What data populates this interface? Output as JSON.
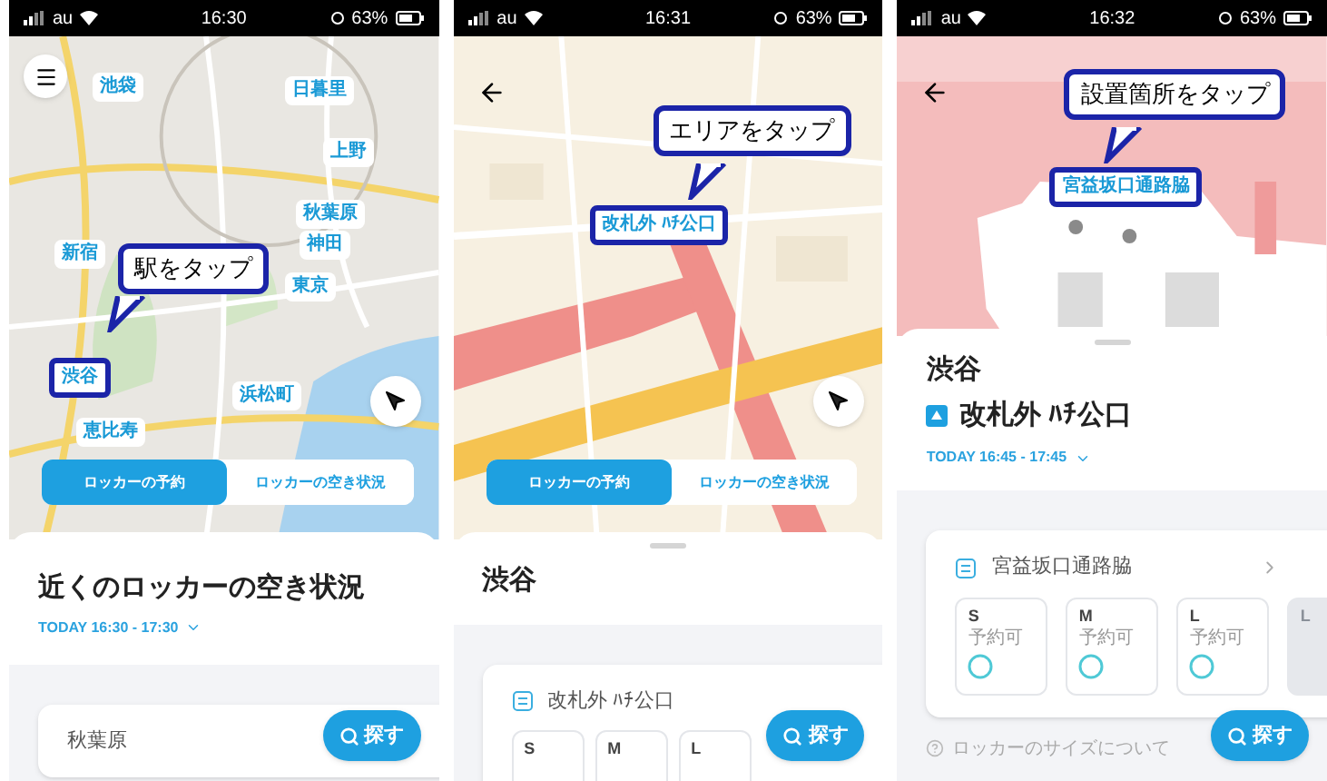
{
  "screens": [
    {
      "status_bar": {
        "carrier": "au",
        "time": "16:30",
        "battery": "63%"
      },
      "nav_button": {
        "kind": "menu"
      },
      "map": {
        "kind": "city",
        "markers": [
          {
            "label": "池袋",
            "highlighted": false
          },
          {
            "label": "日暮里",
            "highlighted": false
          },
          {
            "label": "上野",
            "highlighted": false
          },
          {
            "label": "秋葉原",
            "highlighted": false
          },
          {
            "label": "神田",
            "highlighted": false
          },
          {
            "label": "東京",
            "highlighted": false
          },
          {
            "label": "新宿",
            "highlighted": false
          },
          {
            "label": "渋谷",
            "highlighted": true
          },
          {
            "label": "浜松町",
            "highlighted": false
          },
          {
            "label": "恵比寿",
            "highlighted": false
          }
        ]
      },
      "callout": "駅をタップ",
      "locate_button": true,
      "tabs": [
        {
          "label": "ロッカーの予約",
          "selected": true
        },
        {
          "label": "ロッカーの空き状況",
          "selected": false
        }
      ],
      "sheet": {
        "kind": "nearby",
        "title": "近くのロッカーの空き状況",
        "time_range": "TODAY 16:30 - 17:30",
        "card": {
          "title": "秋葉原"
        }
      },
      "search_button": "探す"
    },
    {
      "status_bar": {
        "carrier": "au",
        "time": "16:31",
        "battery": "63%"
      },
      "nav_button": {
        "kind": "back"
      },
      "map": {
        "kind": "area",
        "markers": [
          {
            "label": "改札外 ﾊﾁ公口",
            "highlighted": true
          }
        ]
      },
      "callout": "エリアをタップ",
      "locate_button": true,
      "tabs": [
        {
          "label": "ロッカーの予約",
          "selected": true
        },
        {
          "label": "ロッカーの空き状況",
          "selected": false
        }
      ],
      "sheet": {
        "kind": "area",
        "title": "渋谷",
        "card": {
          "title": "改札外 ﾊﾁ公口",
          "sizes": [
            {
              "label": "S",
              "disabled": false
            },
            {
              "label": "M",
              "disabled": false
            },
            {
              "label": "L",
              "disabled": false
            }
          ]
        }
      },
      "search_button": "探す"
    },
    {
      "status_bar": {
        "carrier": "au",
        "time": "16:32",
        "battery": "63%"
      },
      "nav_button": {
        "kind": "back"
      },
      "map": {
        "kind": "station",
        "markers": [
          {
            "label": "宮益坂口通路脇",
            "highlighted": true
          }
        ]
      },
      "callout": "設置箇所をタップ",
      "locate_button": false,
      "sheet": {
        "kind": "spot",
        "title": "渋谷",
        "subtitle": "改札外 ﾊﾁ公口",
        "time_range": "TODAY 16:45 - 17:45",
        "card": {
          "title": "宮益坂口通路脇",
          "sizes": [
            {
              "label": "S",
              "status": "予約可",
              "disabled": false
            },
            {
              "label": "M",
              "status": "予約可",
              "disabled": false
            },
            {
              "label": "L",
              "status": "予約可",
              "disabled": false
            },
            {
              "label": "L",
              "disabled": true
            }
          ]
        },
        "footer_link": "ロッカーのサイズについて"
      },
      "search_button": "探す"
    }
  ]
}
